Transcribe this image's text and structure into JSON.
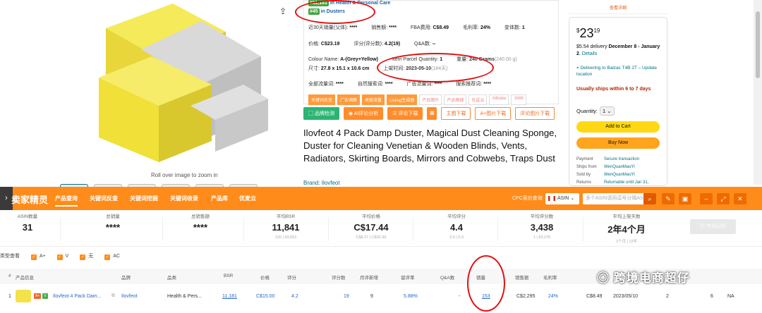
{
  "product": {
    "zoom_hint": "Roll over image to zoom in",
    "title": "Ilovfeot 4 Pack Damp Duster, Magical Dust Cleaning Sponge, Duster for Cleaning Venetian & Wooden Blinds, Vents, Radiators, Skirting Boards, Mirrors and Cobwebs, Traps Dust",
    "brand": "Brand: Ilovfeot"
  },
  "ext": {
    "rank1_badge": "#11,181",
    "rank1_cat": " in Health & Personal Care",
    "rank2_badge": "#45",
    "rank2_cat": " in Dusters",
    "r3": [
      {
        "k": "近30天销量(父体):",
        "v": "****"
      },
      {
        "k": "销售额:",
        "v": "****"
      },
      {
        "k": "FBA费用:",
        "v": "C$8.49"
      },
      {
        "k": "毛利率:",
        "v": "24%"
      },
      {
        "k": "变体数:",
        "v": "1"
      }
    ],
    "r4": [
      {
        "k": "价格:",
        "v": "C$23.19"
      },
      {
        "k": "评分(评分数):",
        "v": "4.2(19)"
      },
      {
        "k": "Q&A数:",
        "v": "--"
      }
    ],
    "r5a_k": "Colour Name:",
    "r5a_v": "A-(Grey+Yellow)",
    "r5b_k": "Item Parcel Quantity:",
    "r5b_v": "1",
    "r5c_k": "重量:",
    "r5c_v": "240 Grams",
    "r5c_extra": "(240.00 g)",
    "r6a_k": "尺寸:",
    "r6a_v": "27.8 x 15.1 x 10.6 cm",
    "r6b_k": "上架时间:",
    "r6b_v": "2023-05-10",
    "r6b_extra": "(184天)",
    "r7": [
      {
        "k": "全部流量词:",
        "v": "****"
      },
      {
        "k": "自然搜索词:",
        "v": "****"
      },
      {
        "k": "广告流量词:",
        "v": "****"
      },
      {
        "k": "搜索推荐词:",
        "v": "****"
      }
    ],
    "tags": [
      "关键词反查",
      "广告洞察",
      "关联流量",
      "Listing生成器",
      "产品图片",
      "产品图搜",
      "优鲨云",
      "Alibaba",
      "1688"
    ]
  },
  "tools": {
    "b1": "品牌检测",
    "b2": "AI评论分析",
    "b3": "评论下载",
    "b4": "主图下载",
    "b5": "A+图片下载",
    "b6": "评论图片下载"
  },
  "buybox": {
    "detail_link": "查看详细",
    "price_int": "23",
    "price_dec": "19",
    "price_sym": "$",
    "delivery_pre": "$5.54 delivery ",
    "delivery_date": "December 8 - January 2",
    "delivery_link": "Details",
    "location": "Delivering to Balzac T4B 2T – Update location",
    "ships": "Usually ships within 6 to 7 days",
    "qty_label": "Quantity:",
    "qty_value": "1",
    "add_cart": "Add to Cart",
    "buy_now": "Buy Now",
    "meta": [
      {
        "k": "Payment",
        "v": "Secure transaction"
      },
      {
        "k": "Ships from",
        "v": "WenQuanMaoYi"
      },
      {
        "k": "Sold by",
        "v": "WenQuanMaoYi"
      },
      {
        "k": "Returns",
        "v": "Returnable until Jan 31,"
      }
    ]
  },
  "plugin": {
    "brand": "卖家精灵",
    "nav": [
      "产品查询",
      "关键词反查",
      "关键词挖掘",
      "关键词收录",
      "产品库",
      "优麦云"
    ],
    "cpc": "CPC竞价查询",
    "country": "ASIN",
    "search_placeholder": "多个ASIN请用逗号分隔ASIN",
    "stats": [
      {
        "lbl": "ASIN数量",
        "val": "31",
        "sub": ""
      },
      {
        "lbl": "总销量",
        "val": "****",
        "sub": ""
      },
      {
        "lbl": "总销售额",
        "val": "****",
        "sub": ""
      },
      {
        "lbl": "平均BSR",
        "val": "11,841",
        "sub": "126  |  43,553"
      },
      {
        "lbl": "平均价格",
        "val": "C$17.44",
        "sub": "C$8.27  |  C$32.95"
      },
      {
        "lbl": "平均评分",
        "val": "4.4",
        "sub": "3.6  |  5.0"
      },
      {
        "lbl": "平均评分数",
        "val": "3,438",
        "sub": "1  |  63,276"
      },
      {
        "lbl": "平均上架天数",
        "val": "2年4个月",
        "sub": "2个月  |  12年"
      }
    ],
    "market_btn": "市场分析",
    "filter_label": "类型查看",
    "filters": [
      "A+",
      "V",
      "无",
      "AC"
    ],
    "cols": [
      "#",
      "产品信息",
      "品牌",
      "品类",
      "BSR",
      "价格",
      "评分",
      "评分数",
      "月评新增",
      "留评率",
      "Q&A数",
      "销量",
      "销售额",
      "毛利率",
      "FBA费用",
      "上架时间",
      "变体数",
      "卖家数",
      "卖家"
    ],
    "row": {
      "idx": "1",
      "name": "Ilovfeot 4 Pack Dam...",
      "brand": "Ilovfeot",
      "cat": "Health & Pers...",
      "bsr": "11,181",
      "price": "C$15.00",
      "rating": "4.2",
      "ratings": "19",
      "monthly": "9",
      "review_rate": "5.88%",
      "qa": "-",
      "sales": "153",
      "revenue": "C$2,295",
      "margin": "24%",
      "fba": "C$8.49",
      "date": "2023/05/10",
      "variants": "2",
      "sellers": "6",
      "seller": "NA"
    }
  },
  "watermark": "跨境电商超仔"
}
